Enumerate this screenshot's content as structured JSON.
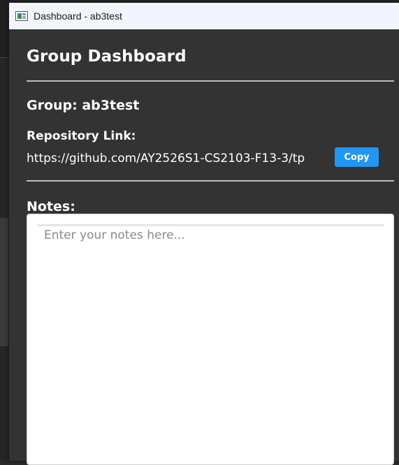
{
  "window": {
    "title": "Dashboard - ab3test",
    "icon": "app-window-icon"
  },
  "dashboard": {
    "heading": "Group Dashboard",
    "group_line": "Group: ab3test",
    "repo_label": "Repository Link:",
    "repo_url": "https://github.com/AY2526S1-CS2103-F13-3/tp",
    "copy_label": "Copy",
    "notes_label": "Notes:",
    "notes_placeholder": "Enter your notes here...",
    "notes_value": ""
  },
  "colors": {
    "window_bg": "#333333",
    "titlebar_bg": "#f2f5fb",
    "accent": "#2196f3",
    "divider": "#bdbdbd",
    "text": "#ffffff"
  }
}
